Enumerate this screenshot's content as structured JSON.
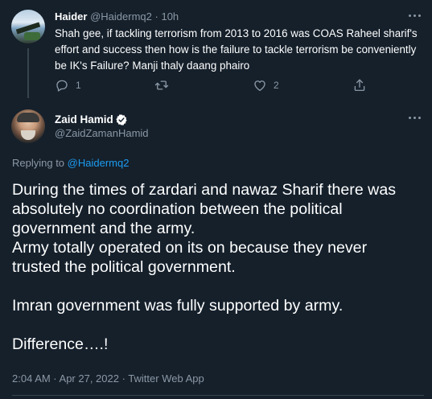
{
  "reply_tweet": {
    "author_name": "Haider",
    "handle": "@Haidermq2",
    "separator": "·",
    "time": "10h",
    "text": "Shah gee, if tackling terrorism from 2013 to 2016 was COAS Raheel sharif's effort and success then how is the failure to tackle terrorism be conveniently be IK's Failure? Manji thaly daang phairo",
    "reply_count": "1",
    "retweet_count": "",
    "like_count": "2",
    "icons": [
      "more-icon",
      "reply-icon",
      "retweet-icon",
      "like-icon",
      "share-icon"
    ]
  },
  "main_tweet": {
    "author_name": "Zaid Hamid",
    "verified": true,
    "handle": "@ZaidZamanHamid",
    "replying_to_label": "Replying to ",
    "replying_to_handle": "@Haidermq2",
    "body_lines": [
      "During the times of zardari and nawaz Sharif there was",
      "absolutely no coordination between the political",
      "government and the army.",
      "Army totally operated on its on because they never",
      "trusted the political government.",
      "",
      "Imran government was fully supported by army.",
      "",
      "Difference….!"
    ],
    "meta": "2:04 AM · Apr 27, 2022 · Twitter Web App",
    "icons": [
      "verified-icon",
      "more-icon"
    ]
  },
  "colors": {
    "background": "#15202b",
    "text": "#ffffff",
    "secondary_text": "#8b98a5",
    "link": "#1d9bf0",
    "divider": "#38444d"
  }
}
